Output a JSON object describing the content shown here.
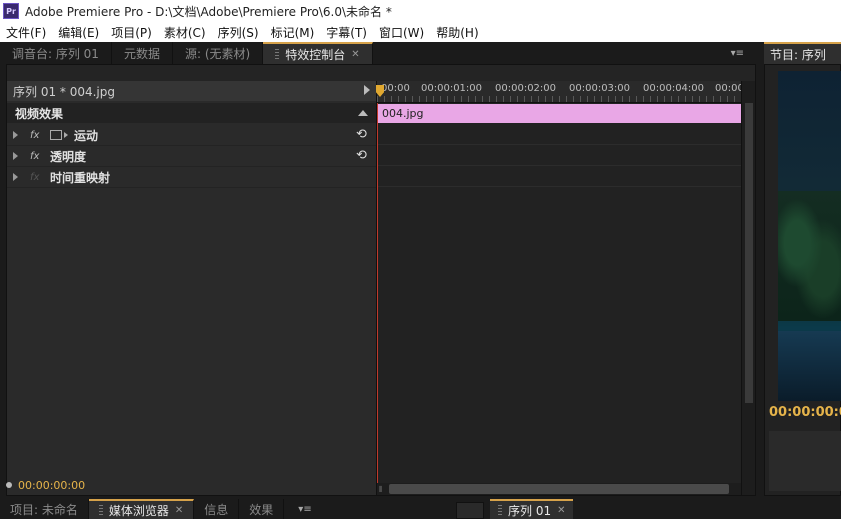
{
  "window": {
    "icon_label": "Pr",
    "title": "Adobe Premiere Pro - D:\\文档\\Adobe\\Premiere Pro\\6.0\\未命名 *"
  },
  "menu": [
    "文件(F)",
    "编辑(E)",
    "项目(P)",
    "素材(C)",
    "序列(S)",
    "标记(M)",
    "字幕(T)",
    "窗口(W)",
    "帮助(H)"
  ],
  "panel_tabs": {
    "mixer": "调音台: 序列 01",
    "metadata": "元数据",
    "source": "源: (无素材)",
    "effect_controls": "特效控制台",
    "menu_icon": "▾≡"
  },
  "effect_controls": {
    "sequence_label": "序列 01 * 004.jpg",
    "video_effects_header": "视频效果",
    "effects": [
      {
        "name": "运动",
        "reset": true
      },
      {
        "name": "透明度",
        "reset": true
      },
      {
        "name": "时间重映射",
        "reset": false
      }
    ],
    "ruler_ticks": [
      "00:00",
      "00:00:01:00",
      "00:00:02:00",
      "00:00:03:00",
      "00:00:04:00",
      "00:00:0"
    ],
    "clip_name": "004.jpg",
    "timecode": "00:00:00:00"
  },
  "program_monitor": {
    "tab_label": "节目: 序列",
    "timecode": "00:00:00:0"
  },
  "bottom_tabs": {
    "project": "项目: 未命名",
    "media_browser": "媒体浏览器",
    "info": "信息",
    "effects": "效果",
    "menu_icon": "▾≡",
    "sequence": "序列 01"
  }
}
